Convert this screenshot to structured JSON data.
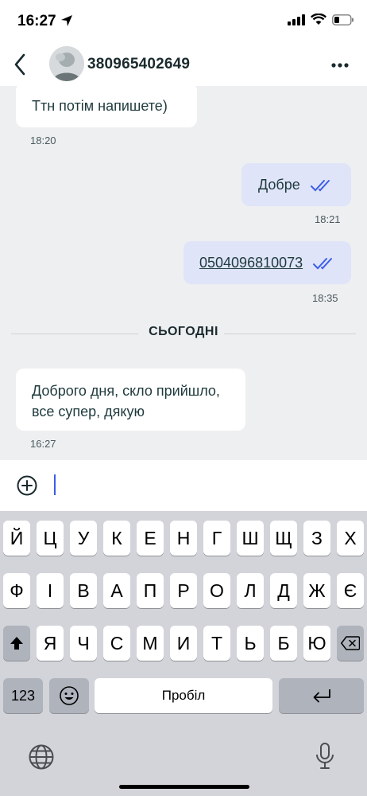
{
  "status_bar": {
    "time": "16:27"
  },
  "header": {
    "contact_name": "380965402649"
  },
  "messages": [
    {
      "direction": "in",
      "text": "Ттн потім напишете)",
      "time": "18:20"
    },
    {
      "direction": "out",
      "text": "Добре",
      "time": "18:21"
    },
    {
      "direction": "out",
      "text": "0504096810073",
      "time": "18:35"
    },
    {
      "direction": "in",
      "text": "Доброго дня, скло прийшло, все супер, дякую",
      "time": "16:27"
    }
  ],
  "date_divider": "СЬОГОДНІ",
  "keyboard": {
    "row1": [
      "Й",
      "Ц",
      "У",
      "К",
      "Е",
      "Н",
      "Г",
      "Ш",
      "Щ",
      "З",
      "Х"
    ],
    "row2": [
      "Ф",
      "І",
      "В",
      "А",
      "П",
      "Р",
      "О",
      "Л",
      "Д",
      "Ж",
      "Є"
    ],
    "row3": [
      "Я",
      "Ч",
      "С",
      "М",
      "И",
      "Т",
      "Ь",
      "Б",
      "Ю"
    ],
    "numbers_label": "123",
    "space_label": "Пробіл"
  },
  "colors": {
    "accent": "#3c5ee8",
    "outgoing_bubble": "#dfe4f8",
    "chat_background": "#eeeff1"
  }
}
